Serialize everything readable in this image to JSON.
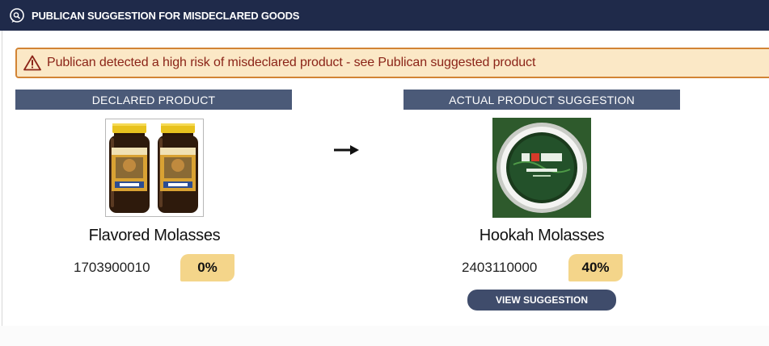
{
  "header": {
    "title": "PUBLICAN SUGGESTION FOR MISDECLARED GOODS",
    "icon": "chat-search-icon"
  },
  "alert": {
    "icon": "warning-triangle-icon",
    "message": "Publican detected a high risk of misdeclared product - see Publican suggested product"
  },
  "declared": {
    "header": "DECLARED PRODUCT",
    "product_name": "Flavored Molasses",
    "code": "1703900010",
    "percentage": "0%"
  },
  "suggested": {
    "header": "ACTUAL PRODUCT SUGGESTION",
    "product_name": "Hookah Molasses",
    "code": "2403110000",
    "percentage": "40%",
    "button_label": "VIEW SUGGESTION"
  },
  "colors": {
    "title_bar": "#1f2a4a",
    "column_header": "#4b5a78",
    "alert_background": "#fbe8c6",
    "alert_border": "#d28434",
    "alert_text": "#8b2418",
    "percentage_badge": "#f4d58a",
    "button": "#3f4c6b"
  }
}
